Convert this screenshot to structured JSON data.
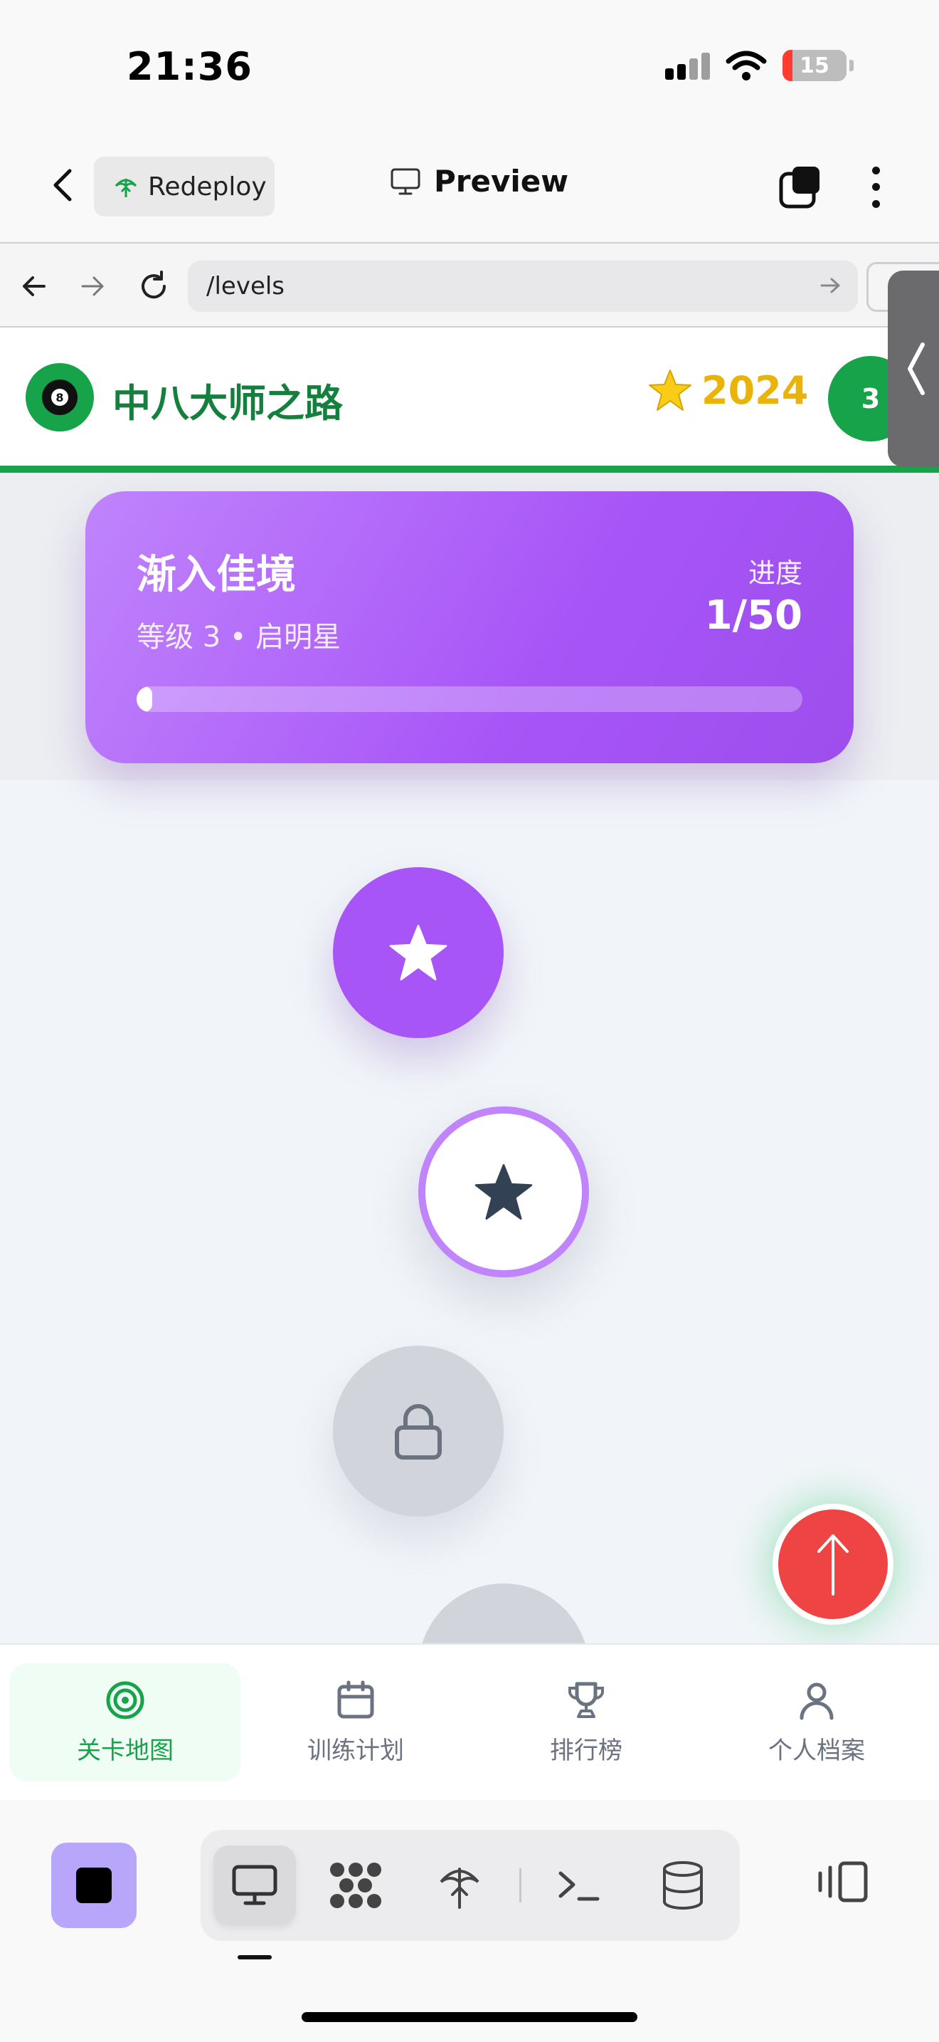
{
  "status_bar": {
    "time": "21:36",
    "battery_level": "15",
    "icons": [
      "cellular-signal-icon",
      "wifi-icon",
      "battery-icon"
    ]
  },
  "toolbar": {
    "redeploy_label": "Redeploy",
    "preview_label": "Preview",
    "icons": [
      "chevron-left-icon",
      "deploy-icon",
      "monitor-icon",
      "tabs-icon",
      "more-vertical-icon"
    ]
  },
  "browser": {
    "url": "/levels",
    "icons": [
      "arrow-left-icon",
      "arrow-right-icon",
      "refresh-icon",
      "go-arrow-icon"
    ]
  },
  "app": {
    "title": "中八大师之路",
    "star_emoji": "⭐",
    "stars_total": "2024",
    "user_level": "3",
    "accent_color": "#16a34a",
    "star_color": "#eab308"
  },
  "progress_card": {
    "title": "渐入佳境",
    "subtitle": "等级 3 • 启明星",
    "progress_label": "进度",
    "progress_value": "1/50",
    "progress_fraction": 0.02,
    "gradient_colors": [
      "#c084fc",
      "#a855f7"
    ]
  },
  "level_nodes": [
    {
      "state": "completed",
      "icon": "star-icon"
    },
    {
      "state": "current",
      "icon": "star-icon"
    },
    {
      "state": "locked",
      "icon": "lock-icon"
    },
    {
      "state": "locked",
      "icon": "none"
    }
  ],
  "fab": {
    "icon": "arrow-up-icon",
    "color": "#ef4444"
  },
  "bottom_nav": {
    "items": [
      {
        "label": "关卡地图",
        "icon": "target-icon",
        "active": true
      },
      {
        "label": "训练计划",
        "icon": "calendar-icon",
        "active": false
      },
      {
        "label": "排行榜",
        "icon": "trophy-icon",
        "active": false
      },
      {
        "label": "个人档案",
        "icon": "user-icon",
        "active": false
      }
    ]
  },
  "ide_bar": {
    "icons": [
      "stop-icon",
      "monitor-icon",
      "apps-grid-icon",
      "deploy-icon",
      "terminal-icon",
      "database-icon",
      "layout-icon"
    ],
    "stop_color": "#b8a6fb"
  }
}
